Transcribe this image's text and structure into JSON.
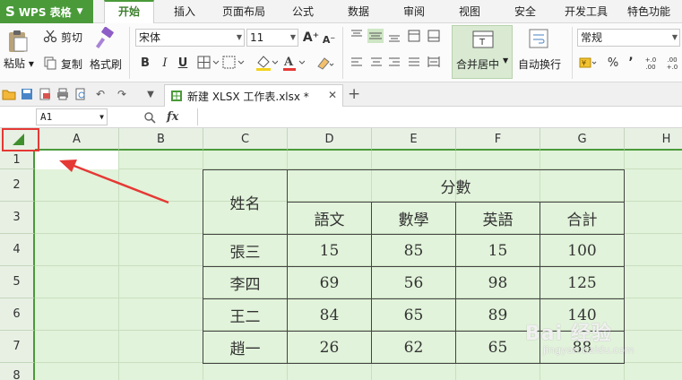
{
  "app": {
    "name": "WPS 表格",
    "logo": "S"
  },
  "menu": {
    "tabs": [
      "开始",
      "插入",
      "页面布局",
      "公式",
      "数据",
      "审阅",
      "视图",
      "安全",
      "开发工具",
      "特色功能"
    ],
    "active": "开始"
  },
  "ribbon": {
    "paste_label": "粘贴",
    "cut_label": "剪切",
    "copy_label": "复制",
    "format_painter_label": "格式刷",
    "font_name": "宋体",
    "font_size": "11",
    "bold": "B",
    "italic": "I",
    "underline": "U",
    "merge_label": "合并居中",
    "wrap_label": "自动换行",
    "number_format": "常规",
    "percent": "%",
    "comma": "’",
    "decimal_inc": "+.0 .00",
    "decimal_dec": ".00 +.0"
  },
  "file_tab": {
    "name": "新建 XLSX 工作表.xlsx *"
  },
  "formula_bar": {
    "name_box": "A1",
    "fx": "fx",
    "value": ""
  },
  "grid": {
    "columns": [
      "A",
      "B",
      "C",
      "D",
      "E",
      "F",
      "G",
      "H"
    ],
    "rows": [
      "1",
      "2",
      "3",
      "4",
      "5",
      "6",
      "7",
      "8"
    ]
  },
  "table": {
    "name_header": "姓名",
    "score_header": "分數",
    "subjects": [
      "語文",
      "數學",
      "英語",
      "合計"
    ],
    "rows": [
      {
        "name": "張三",
        "values": [
          "15",
          "85",
          "15",
          "100"
        ]
      },
      {
        "name": "李四",
        "values": [
          "69",
          "56",
          "98",
          "125"
        ]
      },
      {
        "name": "王二",
        "values": [
          "84",
          "65",
          "89",
          "140"
        ]
      },
      {
        "name": "趙一",
        "values": [
          "26",
          "62",
          "65",
          "88"
        ]
      }
    ]
  },
  "colors": {
    "accent": "#4a9a3a",
    "sheet_bg": "#e1f3da",
    "annotation": "#e53935"
  },
  "watermark": {
    "main": "Bai 经验",
    "sub": "jingyan.baidu.com"
  }
}
